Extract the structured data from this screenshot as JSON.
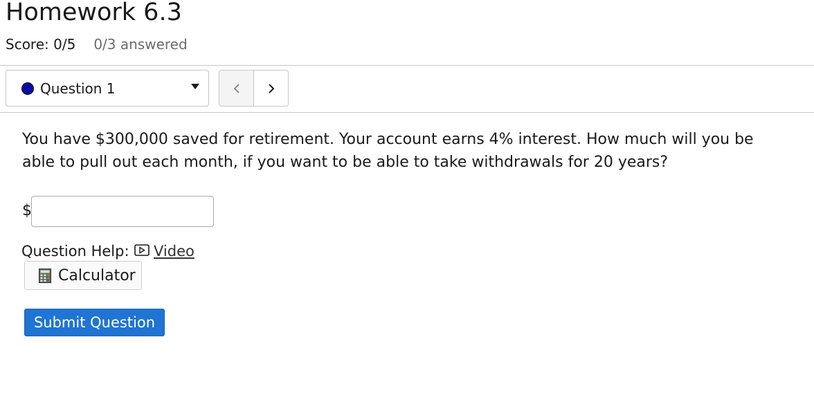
{
  "page": {
    "title": "Homework 6.3",
    "score": "Score: 0/5",
    "answered": "0/3 answered"
  },
  "question_nav": {
    "selected": "Question 1",
    "status_color": "#0a0aa8",
    "prev_icon": "chevron-left-icon",
    "next_icon": "chevron-right-icon"
  },
  "question": {
    "text": "You have $300,000 saved for retirement. Your account earns 4% interest. How much will you be able to pull out each month, if you want to be able to take withdrawals for 20 years?",
    "currency_symbol": "$",
    "answer_value": "",
    "answer_placeholder": ""
  },
  "help": {
    "label": "Question Help:",
    "video_label": "Video",
    "video_icon": "video-play-icon",
    "calculator_label": "Calculator",
    "calculator_icon": "calculator-icon"
  },
  "actions": {
    "submit_label": "Submit Question",
    "submit_color": "#1f74d4"
  }
}
